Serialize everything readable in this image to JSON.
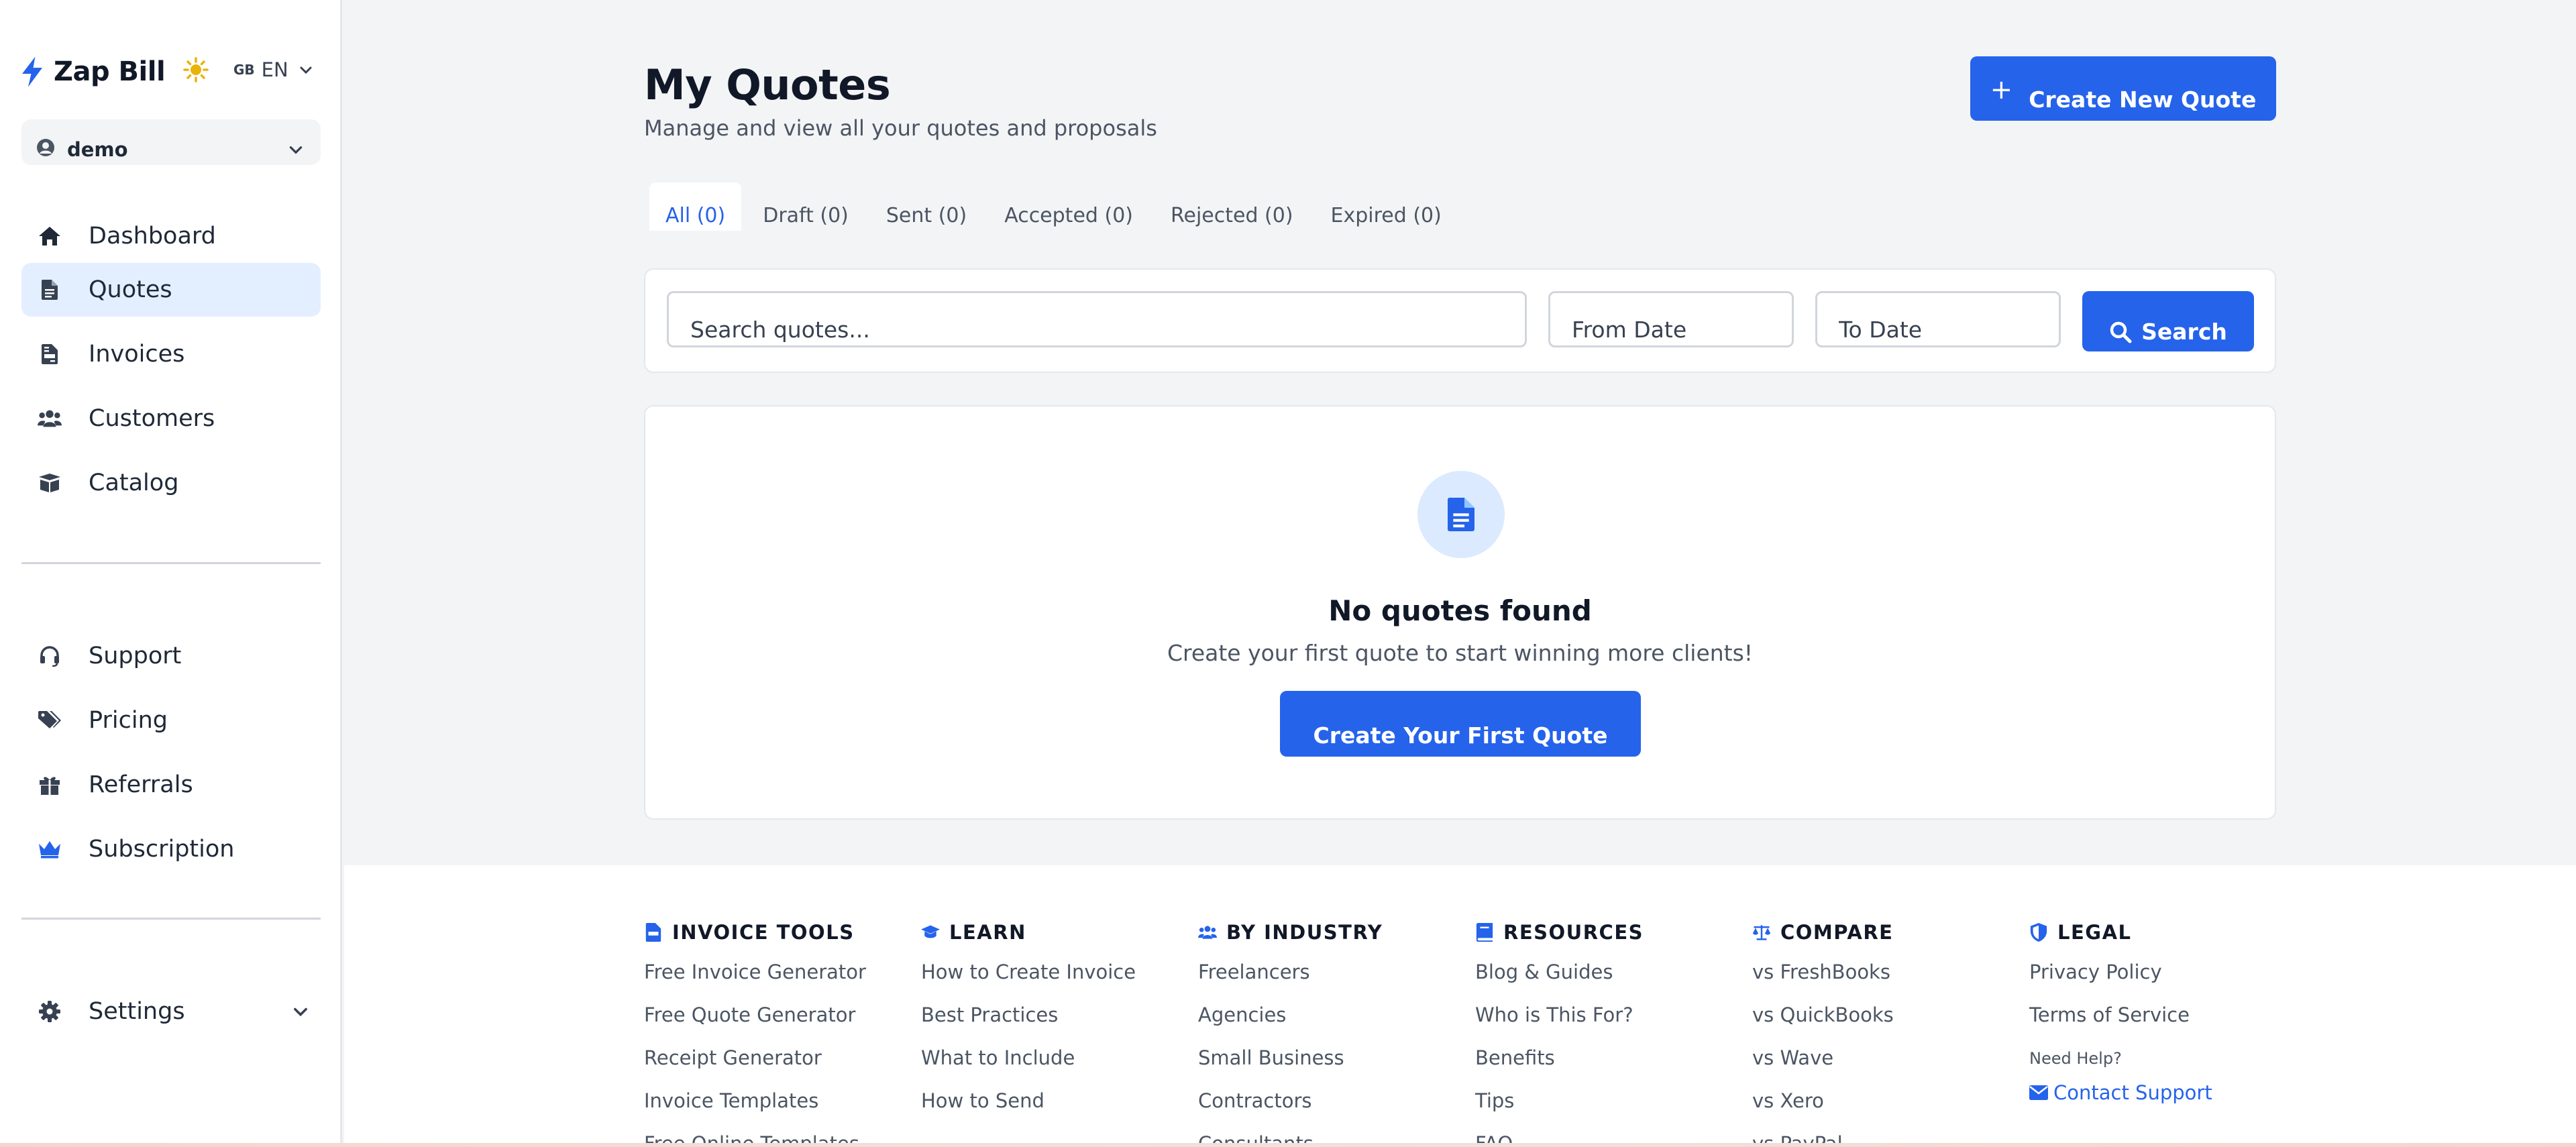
{
  "brand": {
    "name": "Zap Bill"
  },
  "language": {
    "flag": "GB",
    "code": "EN"
  },
  "user": {
    "name": "demo"
  },
  "nav": {
    "main": [
      {
        "label": "Dashboard",
        "icon": "home-icon"
      },
      {
        "label": "Quotes",
        "icon": "file-icon",
        "active": true
      },
      {
        "label": "Invoices",
        "icon": "invoice-icon"
      },
      {
        "label": "Customers",
        "icon": "users-icon"
      },
      {
        "label": "Catalog",
        "icon": "box-icon"
      }
    ],
    "secondary": [
      {
        "label": "Support",
        "icon": "headset-icon"
      },
      {
        "label": "Pricing",
        "icon": "tags-icon"
      },
      {
        "label": "Referrals",
        "icon": "gift-icon"
      },
      {
        "label": "Subscription",
        "icon": "crown-icon"
      }
    ],
    "settings": {
      "label": "Settings",
      "icon": "gear-icon"
    }
  },
  "page": {
    "title": "My Quotes",
    "subtitle": "Manage and view all your quotes and proposals",
    "create_button": "Create New Quote"
  },
  "tabs": [
    {
      "label": "All (0)",
      "active": true
    },
    {
      "label": "Draft (0)"
    },
    {
      "label": "Sent (0)"
    },
    {
      "label": "Accepted (0)"
    },
    {
      "label": "Rejected (0)"
    },
    {
      "label": "Expired (0)"
    }
  ],
  "search": {
    "placeholder": "Search quotes...",
    "from_placeholder": "From Date",
    "to_placeholder": "To Date",
    "button": "Search"
  },
  "empty_state": {
    "title": "No quotes found",
    "subtitle": "Create your first quote to start winning more clients!",
    "button": "Create Your First Quote"
  },
  "footer": {
    "columns": [
      {
        "heading": "INVOICE TOOLS",
        "icon": "invoice-icon",
        "links": [
          "Free Invoice Generator",
          "Free Quote Generator",
          "Receipt Generator",
          "Invoice Templates",
          "Free Online Templates"
        ]
      },
      {
        "heading": "LEARN",
        "icon": "graduation-cap-icon",
        "links": [
          "How to Create Invoice",
          "Best Practices",
          "What to Include",
          "How to Send"
        ]
      },
      {
        "heading": "BY INDUSTRY",
        "icon": "users-icon",
        "links": [
          "Freelancers",
          "Agencies",
          "Small Business",
          "Contractors",
          "Consultants"
        ]
      },
      {
        "heading": "RESOURCES",
        "icon": "book-icon",
        "links": [
          "Blog & Guides",
          "Who is This For?",
          "Benefits",
          "Tips",
          "FAQ"
        ]
      },
      {
        "heading": "COMPARE",
        "icon": "scale-icon",
        "links": [
          "vs FreshBooks",
          "vs QuickBooks",
          "vs Wave",
          "vs Xero",
          "vs PayPal"
        ]
      },
      {
        "heading": "LEGAL",
        "icon": "shield-icon",
        "links": [
          "Privacy Policy",
          "Terms of Service"
        ],
        "help_label": "Need Help?",
        "contact": "Contact Support"
      }
    ]
  },
  "colors": {
    "accent": "#2563eb",
    "active_bg": "#e3efff",
    "sun": "#eab308"
  }
}
